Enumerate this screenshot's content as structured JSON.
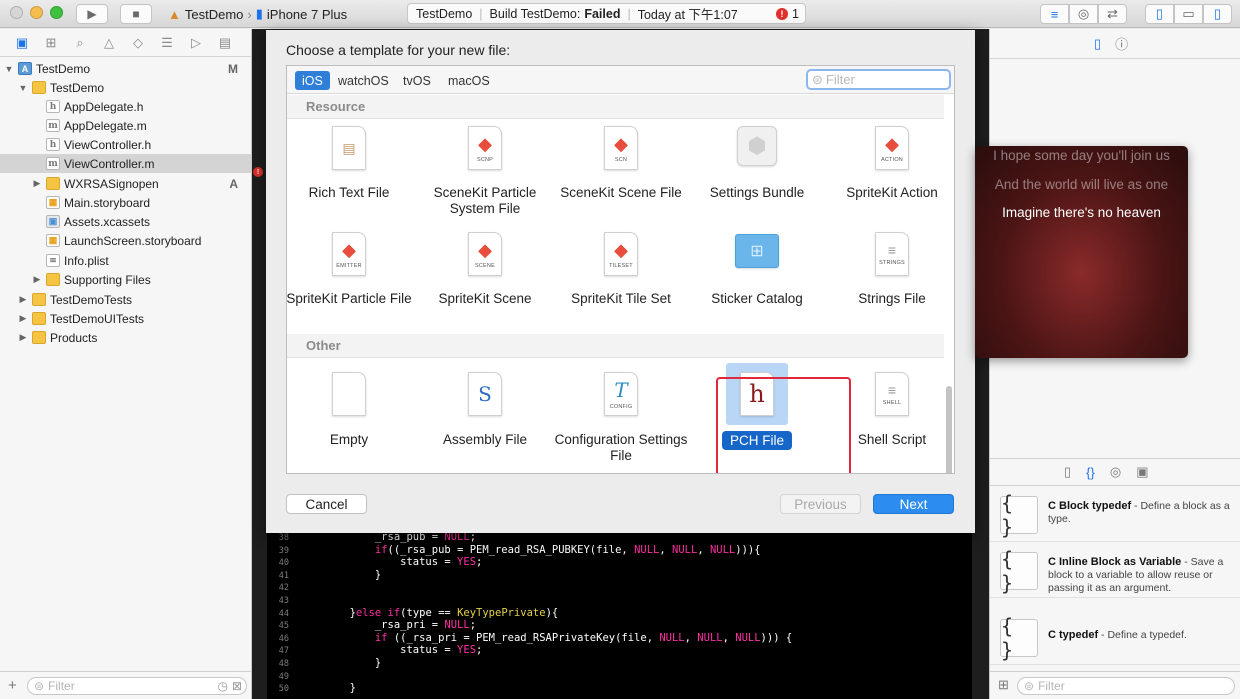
{
  "toolbar": {
    "scheme": "TestDemo",
    "device": "iPhone 7 Plus",
    "status_project": "TestDemo",
    "status_build": "Build TestDemo:",
    "status_result": "Failed",
    "status_time": "Today at 下午1:07",
    "error_count": "1",
    "traffic_colors": [
      "#d6d6d6",
      "#f5be4f",
      "#3ec13f"
    ]
  },
  "navigator": {
    "items": [
      {
        "label": "TestDemo",
        "badge": "M"
      },
      {
        "label": "TestDemo",
        "badge": ""
      },
      {
        "label": "AppDelegate.h",
        "badge": ""
      },
      {
        "label": "AppDelegate.m",
        "badge": ""
      },
      {
        "label": "ViewController.h",
        "badge": ""
      },
      {
        "label": "ViewController.m",
        "badge": ""
      },
      {
        "label": "WXRSASignopen",
        "badge": "A"
      },
      {
        "label": "Main.storyboard",
        "badge": ""
      },
      {
        "label": "Assets.xcassets",
        "badge": ""
      },
      {
        "label": "LaunchScreen.storyboard",
        "badge": ""
      },
      {
        "label": "Info.plist",
        "badge": ""
      },
      {
        "label": "Supporting Files",
        "badge": ""
      },
      {
        "label": "TestDemoTests",
        "badge": ""
      },
      {
        "label": "TestDemoUITests",
        "badge": ""
      },
      {
        "label": "Products",
        "badge": ""
      }
    ],
    "filter_placeholder": "Filter"
  },
  "sheet": {
    "title": "Choose a template for your new file:",
    "platforms": [
      "iOS",
      "watchOS",
      "tvOS",
      "macOS"
    ],
    "filter_placeholder": "Filter",
    "section_resource": "Resource",
    "section_other": "Other",
    "resource_row1": [
      {
        "label": "Rich Text File",
        "cap": ""
      },
      {
        "label": "SceneKit Particle System File",
        "cap": "SCNP"
      },
      {
        "label": "SceneKit Scene File",
        "cap": "SCN"
      },
      {
        "label": "Settings Bundle",
        "cap": ""
      },
      {
        "label": "SpriteKit Action",
        "cap": "ACTION"
      }
    ],
    "resource_row2": [
      {
        "label": "SpriteKit Particle File",
        "cap": "EMITTER"
      },
      {
        "label": "SpriteKit Scene",
        "cap": "SCENE"
      },
      {
        "label": "SpriteKit Tile Set",
        "cap": "TILESET"
      },
      {
        "label": "Sticker Catalog",
        "cap": ""
      },
      {
        "label": "Strings File",
        "cap": "STRINGS"
      }
    ],
    "other_row": [
      {
        "label": "Empty",
        "cap": ""
      },
      {
        "label": "Assembly File",
        "cap": "",
        "glyph": "S"
      },
      {
        "label": "Configuration Settings File",
        "cap": "CONFIG",
        "glyph": "T"
      },
      {
        "label": "PCH File",
        "cap": "",
        "glyph": "h"
      },
      {
        "label": "Shell Script",
        "cap": "SHELL"
      }
    ],
    "cancel": "Cancel",
    "previous": "Previous",
    "next": "Next"
  },
  "code": {
    "lines": [
      {
        "n": "38",
        "parts": [
          [
            "",
            "            _rsa_pub = "
          ],
          [
            "kw",
            "NULL"
          ],
          [
            "",
            ";"
          ]
        ]
      },
      {
        "n": "39",
        "parts": [
          [
            "",
            "            "
          ],
          [
            "kw",
            "if"
          ],
          [
            "",
            "((_rsa_pub = PEM_read_RSA_PUBKEY(file, "
          ],
          [
            "kw",
            "NULL"
          ],
          [
            "",
            ", "
          ],
          [
            "kw",
            "NULL"
          ],
          [
            "",
            ", "
          ],
          [
            "kw",
            "NULL"
          ],
          [
            "",
            "))){"
          ]
        ]
      },
      {
        "n": "40",
        "parts": [
          [
            "",
            "                status = "
          ],
          [
            "kw",
            "YES"
          ],
          [
            "",
            ";"
          ]
        ]
      },
      {
        "n": "41",
        "parts": [
          [
            "",
            "            }"
          ]
        ]
      },
      {
        "n": "42",
        "parts": [
          [
            "",
            ""
          ]
        ]
      },
      {
        "n": "43",
        "parts": [
          [
            "",
            ""
          ]
        ]
      },
      {
        "n": "44",
        "parts": [
          [
            "",
            "        }"
          ],
          [
            "kw",
            "else if"
          ],
          [
            "",
            "(type == "
          ],
          [
            "ty",
            "KeyTypePrivate"
          ],
          [
            "",
            "){"
          ]
        ]
      },
      {
        "n": "45",
        "parts": [
          [
            "",
            "            _rsa_pri = "
          ],
          [
            "kw",
            "NULL"
          ],
          [
            "",
            ";"
          ]
        ]
      },
      {
        "n": "46",
        "parts": [
          [
            "",
            "            "
          ],
          [
            "kw",
            "if"
          ],
          [
            "",
            " ((_rsa_pri = PEM_read_RSAPrivateKey(file, "
          ],
          [
            "kw",
            "NULL"
          ],
          [
            "",
            ", "
          ],
          [
            "kw",
            "NULL"
          ],
          [
            "",
            ", "
          ],
          [
            "kw",
            "NULL"
          ],
          [
            "",
            "))) {"
          ]
        ]
      },
      {
        "n": "47",
        "parts": [
          [
            "",
            "                status = "
          ],
          [
            "kw",
            "YES"
          ],
          [
            "",
            ";"
          ]
        ]
      },
      {
        "n": "48",
        "parts": [
          [
            "",
            "            }"
          ]
        ]
      },
      {
        "n": "49",
        "parts": [
          [
            "",
            ""
          ]
        ]
      },
      {
        "n": "50",
        "parts": [
          [
            "",
            "        }"
          ]
        ]
      }
    ]
  },
  "library": {
    "items": [
      {
        "name": "C Block typedef",
        "desc": " - Define a block as a type."
      },
      {
        "name": "C Inline Block as Variable",
        "desc": " - Save a block to a variable to allow reuse or passing it as an argument."
      },
      {
        "name": "C typedef",
        "desc": " - Define a typedef."
      }
    ],
    "icon_glyph": "{ }",
    "filter_placeholder": "Filter"
  },
  "lyrics": {
    "line1": "I hope some day you'll join us",
    "line2": "And the world will live as one",
    "line3": "Imagine there's no heaven"
  }
}
